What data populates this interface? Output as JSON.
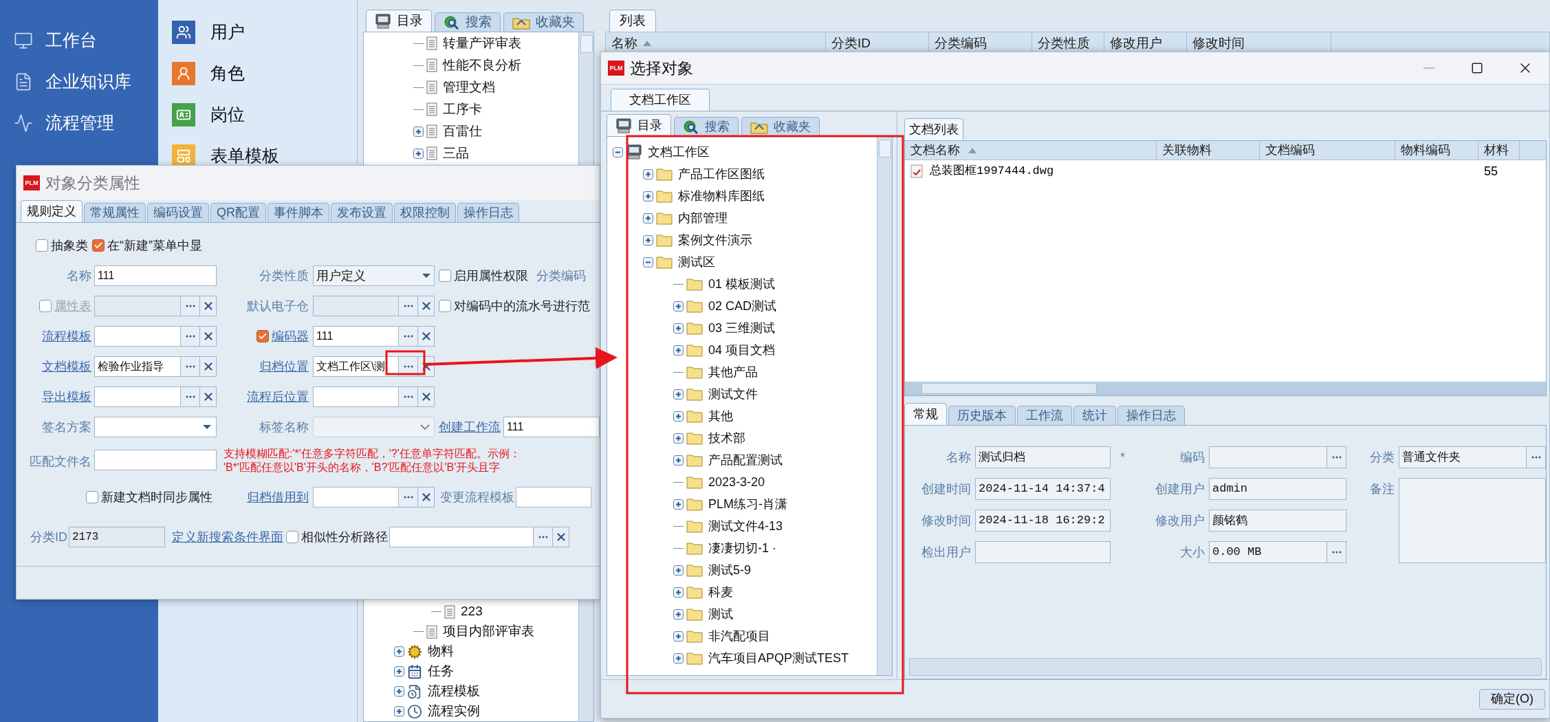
{
  "sidebar": {
    "items": [
      {
        "label": "工作台"
      },
      {
        "label": "企业知识库"
      },
      {
        "label": "流程管理"
      }
    ]
  },
  "menu_panel": {
    "items": [
      {
        "label": "用户",
        "color": "#3561ad"
      },
      {
        "label": "角色",
        "color": "#e8772e"
      },
      {
        "label": "岗位",
        "color": "#46a24a"
      },
      {
        "label": "表单模板",
        "color": "#f0b43c"
      }
    ]
  },
  "tree_panel": {
    "tabs": [
      {
        "label": "目录",
        "selected": true
      },
      {
        "label": "搜索",
        "selected": false
      },
      {
        "label": "收藏夹",
        "selected": false
      }
    ],
    "nodes": [
      {
        "label": "转量产评审表",
        "kind": "doc"
      },
      {
        "label": "性能不良分析",
        "kind": "doc"
      },
      {
        "label": "管理文档",
        "kind": "doc"
      },
      {
        "label": "工序卡",
        "kind": "doc"
      },
      {
        "label": "百雷仕",
        "kind": "doc",
        "expanded": false
      },
      {
        "label": "三品",
        "kind": "doc",
        "expanded": false
      }
    ],
    "branch_tail": [
      {
        "label": "223",
        "kind": "doc"
      }
    ],
    "nodes_after_branch": [
      {
        "label": "项目内部评审表",
        "kind": "doc"
      }
    ],
    "root_nodes": [
      {
        "label": "物料",
        "kind": "material",
        "expanded": false
      },
      {
        "label": "任务",
        "kind": "task",
        "expanded": false
      },
      {
        "label": "流程模板",
        "kind": "flow_template",
        "expanded": false
      },
      {
        "label": "流程实例",
        "kind": "flow_instance",
        "expanded": false
      }
    ]
  },
  "list_panel": {
    "tabs": [
      {
        "label": "列表",
        "selected": true
      }
    ],
    "columns": [
      {
        "label": "名称",
        "sorted": true
      },
      {
        "label": "分类ID"
      },
      {
        "label": "分类编码"
      },
      {
        "label": "分类性质"
      },
      {
        "label": "修改用户"
      },
      {
        "label": "修改时间"
      }
    ]
  },
  "class_dialog": {
    "logo_text": "PLM",
    "title": "对象分类属性",
    "tabs": [
      {
        "label": "规则定义",
        "selected": true
      },
      {
        "label": "常规属性",
        "selected": false
      },
      {
        "label": "编码设置",
        "selected": false
      },
      {
        "label": "QR配置",
        "selected": false
      },
      {
        "label": "事件脚本",
        "selected": false
      },
      {
        "label": "发布设置",
        "selected": false
      },
      {
        "label": "权限控制",
        "selected": false
      },
      {
        "label": "操作日志",
        "selected": false
      }
    ],
    "abstract": {
      "label": "抽象类",
      "checked": false
    },
    "show_in_new": {
      "label": "在“新建”菜单中显",
      "checked": true
    },
    "name": {
      "label": "名称",
      "value": "111"
    },
    "category_nature": {
      "label": "分类性质",
      "value": "用户定义"
    },
    "enable_attr_permission": {
      "label": "启用属性权限",
      "checked": false
    },
    "category_code_label": "分类编码",
    "attribute_table": {
      "label": "属性表",
      "checked": false,
      "disabled": true
    },
    "default_vault": {
      "label": "默认电子仓"
    },
    "serial_range": {
      "label": "对编码中的流水号进行范",
      "checked": false
    },
    "process_template": {
      "label": "流程模板"
    },
    "encoder": {
      "label": "编码器",
      "checked": true,
      "value": "111"
    },
    "doc_template": {
      "label": "文档模板",
      "value": "检验作业指导"
    },
    "archive_location": {
      "label": "归档位置",
      "value": "文档工作区\\测"
    },
    "export_template": {
      "label": "导出模板"
    },
    "post_flow_location": {
      "label": "流程后位置"
    },
    "signature_scheme": {
      "label": "签名方案"
    },
    "tag_name": {
      "label": "标签名称"
    },
    "create_workflow": {
      "label": "创建工作流",
      "value": "111"
    },
    "match_filename": {
      "label": "匹配文件名"
    },
    "match_hint": [
      "支持模糊匹配:'*'任意多字符匹配，'?'任意单字符匹配。示例：",
      "'B*'匹配任意以'B'开头的名称，'B?'匹配任意以'B'开头且字"
    ],
    "sync_attrs": {
      "label": "新建文档时同步属性",
      "checked": false
    },
    "archive_borrow": {
      "label": "归档借用到"
    },
    "change_flow_template": {
      "label": "变更流程模板"
    },
    "category_id": {
      "label": "分类ID",
      "value": "2173"
    },
    "define_search_ui": "定义新搜索条件界面",
    "similarity_path": {
      "label": "相似性分析路径",
      "checked": false
    }
  },
  "select_dialog": {
    "logo_text": "PLM",
    "title": "选择对象",
    "workspace_tabs": [
      {
        "label": "文档工作区",
        "selected": true
      }
    ],
    "tree_tabs": [
      {
        "label": "目录",
        "selected": true
      },
      {
        "label": "搜索",
        "selected": false
      },
      {
        "label": "收藏夹",
        "selected": false
      }
    ],
    "tree": [
      {
        "label": "文档工作区",
        "kind": "workspace",
        "expanded": true,
        "children": [
          {
            "label": "产品工作区图纸",
            "kind": "folder",
            "expanded": false
          },
          {
            "label": "标准物料库图纸",
            "kind": "folder",
            "expanded": false
          },
          {
            "label": "内部管理",
            "kind": "folder",
            "expanded": false
          },
          {
            "label": "案例文件演示",
            "kind": "folder",
            "expanded": false
          },
          {
            "label": "测试区",
            "kind": "folder",
            "expanded": true,
            "children": [
              {
                "label": "01 模板测试",
                "kind": "folder"
              },
              {
                "label": "02 CAD测试",
                "kind": "folder",
                "expanded": false
              },
              {
                "label": "03 三维测试",
                "kind": "folder",
                "expanded": false
              },
              {
                "label": "04 项目文档",
                "kind": "folder",
                "expanded": false
              },
              {
                "label": "其他产品",
                "kind": "folder"
              },
              {
                "label": "测试文件",
                "kind": "folder",
                "expanded": false
              },
              {
                "label": "其他",
                "kind": "folder",
                "expanded": false
              },
              {
                "label": "技术部",
                "kind": "folder",
                "expanded": false
              },
              {
                "label": "产品配置测试",
                "kind": "folder",
                "expanded": false
              },
              {
                "label": "2023-3-20",
                "kind": "folder"
              },
              {
                "label": "PLM练习-肖潇",
                "kind": "folder",
                "expanded": false
              },
              {
                "label": "测试文件4-13",
                "kind": "folder"
              },
              {
                "label": "凄凄切切-1 ·",
                "kind": "folder"
              },
              {
                "label": "测试5-9",
                "kind": "folder",
                "expanded": false
              },
              {
                "label": "科麦",
                "kind": "folder",
                "expanded": false
              },
              {
                "label": "测试",
                "kind": "folder",
                "expanded": false
              },
              {
                "label": "非汽配项目",
                "kind": "folder",
                "expanded": false
              },
              {
                "label": "汽车项目APQP测试TEST",
                "kind": "folder",
                "expanded": false
              }
            ]
          }
        ]
      }
    ],
    "doc_list": {
      "tabs": [
        {
          "label": "文档列表",
          "selected": true
        }
      ],
      "columns": [
        {
          "label": "文档名称",
          "sorted": true
        },
        {
          "label": "关联物料"
        },
        {
          "label": "文档编码"
        },
        {
          "label": "物料编码"
        },
        {
          "label": "材料"
        }
      ],
      "rows": [
        {
          "document_name": "总装图框1997444.dwg",
          "material": "55"
        }
      ]
    },
    "detail_tabs": [
      {
        "label": "常规",
        "selected": true
      },
      {
        "label": "历史版本",
        "selected": false
      },
      {
        "label": "工作流",
        "selected": false
      },
      {
        "label": "统计",
        "selected": false
      },
      {
        "label": "操作日志",
        "selected": false
      }
    ],
    "detail": {
      "name": {
        "label": "名称",
        "value": "测试归档",
        "required_mark": "*"
      },
      "code": {
        "label": "编码"
      },
      "category": {
        "label": "分类",
        "value": "普通文件夹"
      },
      "created_at": {
        "label": "创建时间",
        "value": "2024-11-14 14:37:4"
      },
      "creator": {
        "label": "创建用户",
        "value": "admin"
      },
      "remark": {
        "label": "备注"
      },
      "modified_at": {
        "label": "修改时间",
        "value": "2024-11-18 16:29:2"
      },
      "modifier": {
        "label": "修改用户",
        "value": "颜铭鹤"
      },
      "checkout_user": {
        "label": "检出用户"
      },
      "size": {
        "label": "大小",
        "value": "0.00 MB"
      }
    },
    "ok_button": "确定(O)"
  }
}
